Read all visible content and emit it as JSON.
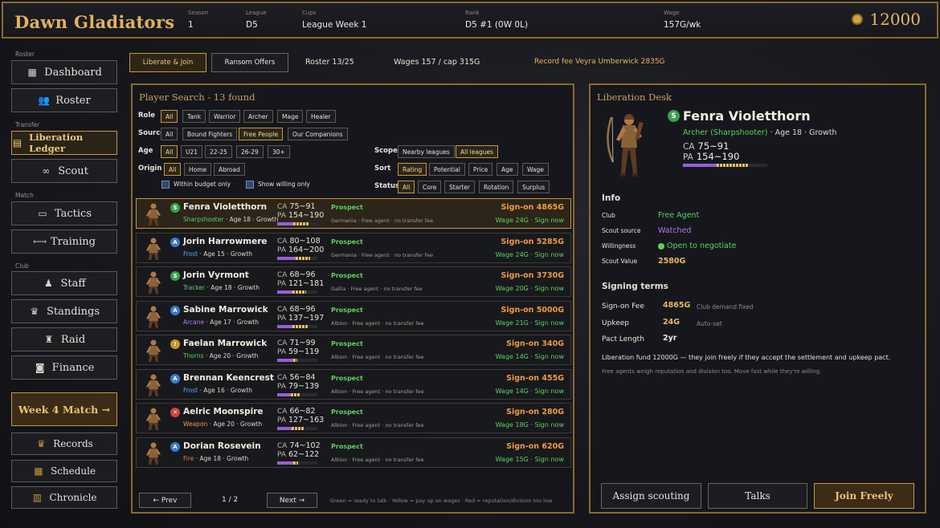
{
  "header": {
    "title": "Dawn Gladiators",
    "stats": [
      {
        "label": "Season",
        "value": "1"
      },
      {
        "label": "League",
        "value": "D5"
      },
      {
        "label": "Cups",
        "value": "League Week 1"
      },
      {
        "label": "Rank",
        "value": "D5 #1 (0W 0L)"
      },
      {
        "label": "Wage",
        "value": "157G/wk"
      }
    ],
    "gold": "12000"
  },
  "sidebar": {
    "sections": {
      "roster": "Roster",
      "transfer": "Transfer",
      "match": "Match",
      "club": "Club"
    },
    "items": {
      "dashboard": "Dashboard",
      "roster": "Roster",
      "liberation": "Liberation Ledger",
      "scout": "Scout",
      "tactics": "Tactics",
      "training": "Training",
      "staff": "Staff",
      "standings": "Standings",
      "raid": "Raid",
      "finance": "Finance",
      "week_match": "Week 4 Match →",
      "records": "Records",
      "schedule": "Schedule",
      "chronicle": "Chronicle"
    }
  },
  "topinfo": {
    "tab_liberate": "Liberate & Join",
    "tab_ransom": "Ransom Offers",
    "roster": "Roster 13/25",
    "wages": "Wages 157 / cap 315G",
    "record_fee": "Record fee Veyra Umberwick 2835G"
  },
  "search": {
    "title": "Player Search - 13 found",
    "labels": {
      "role": "Role",
      "source": "Source",
      "age": "Age",
      "origin": "Origin",
      "scope": "Scope",
      "sort": "Sort",
      "status": "Status"
    },
    "role": [
      "All",
      "Tank",
      "Warrior",
      "Archer",
      "Mage",
      "Healer"
    ],
    "source": [
      "All",
      "Bound Fighters",
      "Free People",
      "Our Companions"
    ],
    "age": [
      "All",
      "U21",
      "22-25",
      "26-29",
      "30+"
    ],
    "origin": [
      "All",
      "Home",
      "Abroad"
    ],
    "scope": [
      "Nearby leagues",
      "All leagues"
    ],
    "sort": [
      "Rating",
      "Potential",
      "Price",
      "Age",
      "Wage"
    ],
    "status": [
      "All",
      "Core",
      "Starter",
      "Rotation",
      "Surplus"
    ],
    "within_budget": "Within budget only",
    "show_willing": "Show willing only",
    "prev": "← Prev",
    "page": "1 / 2",
    "next": "Next →",
    "legend": "Green = ready to talk · Yellow = pay up on wages · Red = reputation/division too low"
  },
  "players": [
    {
      "name": "Fenra Violetthorn",
      "badge": "S",
      "badge_color": "#3aa050",
      "role": "Sharpshooter",
      "role_color": "#5fd060",
      "rest": " · Age 18 · Growth",
      "ca_label": "CA",
      "ca": "75~91",
      "pa_label": "PA",
      "pa": "154~190",
      "ca_frac": 0.4,
      "pa_frac": 0.78,
      "status": "Prospect",
      "note": "Germania · Free agent · no transfer fee",
      "sign": "Sign-on 4865G",
      "wage": "Wage 24G · Sign now"
    },
    {
      "name": "Jorin Harrowmere",
      "badge": "A",
      "badge_color": "#3a78d0",
      "role": "Frost",
      "role_color": "#5aa8f0",
      "rest": " · Age 15 · Growth",
      "ca_label": "CA",
      "ca": "80~108",
      "pa_label": "PA",
      "pa": "164~200",
      "ca_frac": 0.45,
      "pa_frac": 0.82,
      "status": "Prospect",
      "note": "Germania · Free agent · no transfer fee",
      "sign": "Sign-on 5285G",
      "wage": "Wage 24G · Sign now"
    },
    {
      "name": "Jorin Vyrmont",
      "badge": "S",
      "badge_color": "#3aa050",
      "role": "Tracker",
      "role_color": "#5fd060",
      "rest": " · Age 18 · Growth",
      "ca_label": "CA",
      "ca": "68~96",
      "pa_label": "PA",
      "pa": "121~181",
      "ca_frac": 0.38,
      "pa_frac": 0.72,
      "status": "Prospect",
      "note": "Gallia · Free agent · no transfer fee",
      "sign": "Sign-on 3730G",
      "wage": "Wage 20G · Sign now"
    },
    {
      "name": "Sabine Marrowick",
      "badge": "A",
      "badge_color": "#3a78d0",
      "role": "Arcane",
      "role_color": "#b07ae8",
      "rest": " · Age 17 · Growth",
      "ca_label": "CA",
      "ca": "68~96",
      "pa_label": "PA",
      "pa": "137~197",
      "ca_frac": 0.38,
      "pa_frac": 0.78,
      "status": "Prospect",
      "note": "Albion · Free agent · no transfer fee",
      "sign": "Sign-on 5000G",
      "wage": "Wage 21G · Sign now"
    },
    {
      "name": "Faelan Marrowick",
      "badge": "!",
      "badge_color": "#c8962a",
      "role": "Thorns",
      "role_color": "#5fd060",
      "rest": " · Age 20 · Growth",
      "ca_label": "CA",
      "ca": "71~99",
      "pa_label": "PA",
      "pa": "59~119",
      "ca_frac": 0.4,
      "pa_frac": 0.5,
      "status": "Prospect",
      "note": "Albion · Free agent · no transfer fee",
      "sign": "Sign-on 340G",
      "wage": "Wage 14G · Sign now"
    },
    {
      "name": "Brennan Keencrest",
      "badge": "A",
      "badge_color": "#3a78d0",
      "role": "Frost",
      "role_color": "#5aa8f0",
      "rest": " · Age 16 · Growth",
      "ca_label": "CA",
      "ca": "56~84",
      "pa_label": "PA",
      "pa": "79~139",
      "ca_frac": 0.33,
      "pa_frac": 0.58,
      "status": "Prospect",
      "note": "Albion · Free agent · no transfer fee",
      "sign": "Sign-on 455G",
      "wage": "Wage 14G · Sign now"
    },
    {
      "name": "Aelric Moonspire",
      "badge": "✕",
      "badge_color": "#d04040",
      "role": "Weapon",
      "role_color": "#ef9a3e",
      "rest": " · Age 20 · Growth",
      "ca_label": "CA",
      "ca": "66~82",
      "pa_label": "PA",
      "pa": "127~163",
      "ca_frac": 0.36,
      "pa_frac": 0.68,
      "status": "Prospect",
      "note": "Albion · Free agent · no transfer fee",
      "sign": "Sign-on 280G",
      "wage": "Wage 18G · Sign now"
    },
    {
      "name": "Dorian Rosevein",
      "badge": "A",
      "badge_color": "#3a78d0",
      "role": "Fire",
      "role_color": "#ef7a3e",
      "rest": " · Age 18 · Growth",
      "ca_label": "CA",
      "ca": "74~102",
      "pa_label": "PA",
      "pa": "62~122",
      "ca_frac": 0.4,
      "pa_frac": 0.52,
      "status": "Prospect",
      "note": "Albion · Free agent · no transfer fee",
      "sign": "Sign-on 620G",
      "wage": "Wage 15G · Sign now"
    }
  ],
  "detail": {
    "panel_title": "Liberation Desk",
    "name": "Fenra Violetthorn",
    "badge": "S",
    "sub": "Archer (Sharpshooter)",
    "sub_rest": " · Age 18 · Growth",
    "ca_label": "CA",
    "ca": "75~91",
    "pa_label": "PA",
    "pa": "154~190",
    "ca_frac": 0.4,
    "pa_frac": 0.78,
    "info_title": "Info",
    "club_label": "Club",
    "club": "Free Agent",
    "scout_label": "Scout source",
    "scout": "Watched",
    "will_label": "Willingness",
    "will": "Open to negotiate",
    "value_label": "Scout Value",
    "value": "2580G",
    "terms_title": "Signing terms",
    "fee_label": "Sign-on Fee",
    "fee": "4865G",
    "fee_note": "Club demand fixed",
    "upkeep_label": "Upkeep",
    "upkeep": "24G",
    "upkeep_note": "Auto-set",
    "pact_label": "Pact Length",
    "pact": "2yr",
    "fund_text": "Liberation fund 12000G — they join freely if they accept the settlement and upkeep pact.",
    "hint_text": "Free agents weigh reputation and division too. Move fast while they're willing.",
    "btn_assign": "Assign scouting",
    "btn_talks": "Talks",
    "btn_join": "Join Freely"
  },
  "colors": {
    "accent": "#c8963c",
    "gold": "#e8b65c",
    "green": "#5fd060",
    "orange": "#ef9a3e",
    "purple": "#9560d8"
  }
}
